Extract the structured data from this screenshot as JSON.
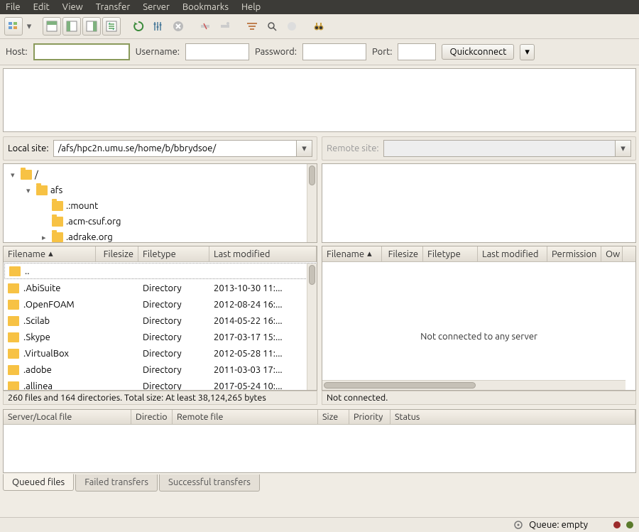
{
  "menu": {
    "items": [
      "File",
      "Edit",
      "View",
      "Transfer",
      "Server",
      "Bookmarks",
      "Help"
    ]
  },
  "quick": {
    "host_label": "Host:",
    "user_label": "Username:",
    "pass_label": "Password:",
    "port_label": "Port:",
    "connect_label": "Quickconnect"
  },
  "local": {
    "label": "Local site:",
    "path": "/afs/hpc2n.umu.se/home/b/bbrydsoe/",
    "tree": [
      {
        "indent": 0,
        "twisty": "▾",
        "name": "/"
      },
      {
        "indent": 1,
        "twisty": "▾",
        "name": "afs"
      },
      {
        "indent": 2,
        "twisty": "",
        "name": ".:mount"
      },
      {
        "indent": 2,
        "twisty": "",
        "name": ".acm-csuf.org"
      },
      {
        "indent": 2,
        "twisty": "▸",
        "name": ".adrake.org"
      }
    ],
    "cols": {
      "filename": "Filename",
      "filesize": "Filesize",
      "filetype": "Filetype",
      "lastmod": "Last modified"
    },
    "rows": [
      {
        "name": "..",
        "type": "",
        "mod": "",
        "up": true
      },
      {
        "name": ".AbiSuite",
        "type": "Directory",
        "mod": "2013-10-30 11:..."
      },
      {
        "name": ".OpenFOAM",
        "type": "Directory",
        "mod": "2012-08-24 16:..."
      },
      {
        "name": ".Scilab",
        "type": "Directory",
        "mod": "2014-05-22 16:..."
      },
      {
        "name": ".Skype",
        "type": "Directory",
        "mod": "2017-03-17 15:..."
      },
      {
        "name": ".VirtualBox",
        "type": "Directory",
        "mod": "2012-05-28 11:..."
      },
      {
        "name": ".adobe",
        "type": "Directory",
        "mod": "2011-03-03 17:..."
      },
      {
        "name": ".allinea",
        "type": "Directory",
        "mod": "2017-05-24 10:..."
      }
    ],
    "status": "260 files and 164 directories. Total size: At least 38,124,265 bytes"
  },
  "remote": {
    "label": "Remote site:",
    "cols": {
      "filename": "Filename",
      "filesize": "Filesize",
      "filetype": "Filetype",
      "lastmod": "Last modified",
      "perm": "Permission",
      "owner": "Ow"
    },
    "empty": "Not connected to any server",
    "status": "Not connected."
  },
  "queue": {
    "cols": {
      "serverlocal": "Server/Local file",
      "direction": "Directio",
      "remote": "Remote file",
      "size": "Size",
      "priority": "Priority",
      "status": "Status"
    }
  },
  "tabs": {
    "queued": "Queued files",
    "failed": "Failed transfers",
    "success": "Successful transfers"
  },
  "bottom": {
    "queue": "Queue: empty"
  }
}
